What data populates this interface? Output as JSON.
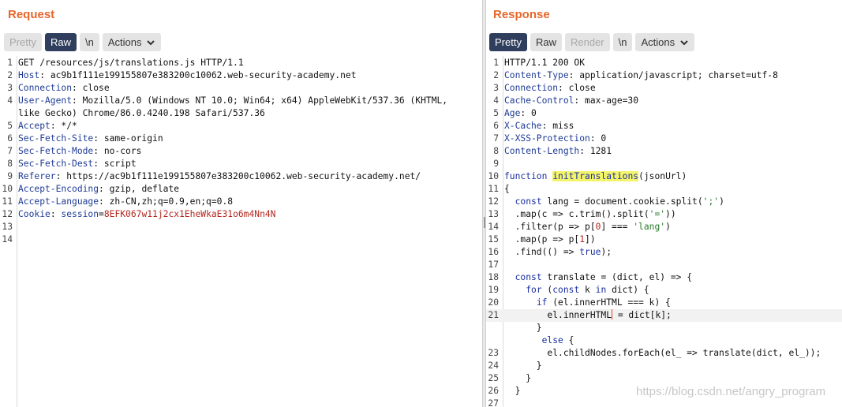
{
  "request": {
    "title": "Request",
    "tabs": {
      "pretty": "Pretty",
      "raw": "Raw",
      "newline": "\\n",
      "actions": "Actions"
    },
    "lines": [
      {
        "n": "1",
        "parts": [
          {
            "t": "GET /resources/js/translations.js HTTP/1.1"
          }
        ]
      },
      {
        "n": "2",
        "parts": [
          {
            "t": "Host",
            "c": "hdr"
          },
          {
            "t": ": ac9b1f111e199155807e383200c10062.web-security-academy.net"
          }
        ]
      },
      {
        "n": "3",
        "parts": [
          {
            "t": "Connection",
            "c": "hdr"
          },
          {
            "t": ": close"
          }
        ]
      },
      {
        "n": "4",
        "parts": [
          {
            "t": "User-Agent",
            "c": "hdr"
          },
          {
            "t": ": Mozilla/5.0 (Windows NT 10.0; Win64; x64) AppleWebKit/537.36 (KHTML,"
          }
        ]
      },
      {
        "n": "",
        "parts": [
          {
            "t": "like Gecko) Chrome/86.0.4240.198 Safari/537.36"
          }
        ]
      },
      {
        "n": "5",
        "parts": [
          {
            "t": "Accept",
            "c": "hdr"
          },
          {
            "t": ": */*"
          }
        ]
      },
      {
        "n": "6",
        "parts": [
          {
            "t": "Sec-Fetch-Site",
            "c": "hdr"
          },
          {
            "t": ": same-origin"
          }
        ]
      },
      {
        "n": "7",
        "parts": [
          {
            "t": "Sec-Fetch-Mode",
            "c": "hdr"
          },
          {
            "t": ": no-cors"
          }
        ]
      },
      {
        "n": "8",
        "parts": [
          {
            "t": "Sec-Fetch-Dest",
            "c": "hdr"
          },
          {
            "t": ": script"
          }
        ]
      },
      {
        "n": "9",
        "parts": [
          {
            "t": "Referer",
            "c": "hdr"
          },
          {
            "t": ": https://ac9b1f111e199155807e383200c10062.web-security-academy.net/"
          }
        ]
      },
      {
        "n": "10",
        "parts": [
          {
            "t": "Accept-Encoding",
            "c": "hdr"
          },
          {
            "t": ": gzip, deflate"
          }
        ]
      },
      {
        "n": "11",
        "parts": [
          {
            "t": "Accept-Language",
            "c": "hdr"
          },
          {
            "t": ": zh-CN,zh;q=0.9,en;q=0.8"
          }
        ]
      },
      {
        "n": "12",
        "parts": [
          {
            "t": "Cookie",
            "c": "hdr"
          },
          {
            "t": ": "
          },
          {
            "t": "session",
            "c": "hdr"
          },
          {
            "t": "="
          },
          {
            "t": "8EFK067w11j2cx1EheWkaE31o6m4Nn4N",
            "c": "cookie-val"
          }
        ]
      },
      {
        "n": "13",
        "parts": []
      },
      {
        "n": "14",
        "parts": []
      }
    ]
  },
  "response": {
    "title": "Response",
    "tabs": {
      "pretty": "Pretty",
      "raw": "Raw",
      "render": "Render",
      "newline": "\\n",
      "actions": "Actions"
    },
    "lines": [
      {
        "n": "1",
        "parts": [
          {
            "t": "HTTP/1.1 200 OK"
          }
        ]
      },
      {
        "n": "2",
        "parts": [
          {
            "t": "Content-Type",
            "c": "hdr"
          },
          {
            "t": ": application/javascript; charset=utf-8"
          }
        ]
      },
      {
        "n": "3",
        "parts": [
          {
            "t": "Connection",
            "c": "hdr"
          },
          {
            "t": ": close"
          }
        ]
      },
      {
        "n": "4",
        "parts": [
          {
            "t": "Cache-Control",
            "c": "hdr"
          },
          {
            "t": ": max-age=30"
          }
        ]
      },
      {
        "n": "5",
        "parts": [
          {
            "t": "Age",
            "c": "hdr"
          },
          {
            "t": ": 0"
          }
        ]
      },
      {
        "n": "6",
        "parts": [
          {
            "t": "X-Cache",
            "c": "hdr"
          },
          {
            "t": ": miss"
          }
        ]
      },
      {
        "n": "7",
        "parts": [
          {
            "t": "X-XSS-Protection",
            "c": "hdr"
          },
          {
            "t": ": 0"
          }
        ]
      },
      {
        "n": "8",
        "parts": [
          {
            "t": "Content-Length",
            "c": "hdr"
          },
          {
            "t": ": 1281"
          }
        ]
      },
      {
        "n": "9",
        "parts": []
      },
      {
        "n": "10",
        "parts": [
          {
            "t": "function",
            "c": "kw"
          },
          {
            "t": " "
          },
          {
            "t": "initTranslations",
            "c": "fn-hl"
          },
          {
            "t": "(jsonUrl)"
          }
        ]
      },
      {
        "n": "11",
        "parts": [
          {
            "t": "{"
          }
        ]
      },
      {
        "n": "12",
        "parts": [
          {
            "t": "  "
          },
          {
            "t": "const",
            "c": "kw"
          },
          {
            "t": " lang = document.cookie.split("
          },
          {
            "t": "';'",
            "c": "str"
          },
          {
            "t": ")"
          }
        ]
      },
      {
        "n": "13",
        "parts": [
          {
            "t": "  .map(c => c.trim().split("
          },
          {
            "t": "'='",
            "c": "str"
          },
          {
            "t": "))"
          }
        ]
      },
      {
        "n": "14",
        "parts": [
          {
            "t": "  .filter(p => p["
          },
          {
            "t": "0",
            "c": "num"
          },
          {
            "t": "] === "
          },
          {
            "t": "'lang'",
            "c": "str"
          },
          {
            "t": ")"
          }
        ]
      },
      {
        "n": "15",
        "parts": [
          {
            "t": "  .map(p => p["
          },
          {
            "t": "1",
            "c": "num"
          },
          {
            "t": "])"
          }
        ]
      },
      {
        "n": "16",
        "parts": [
          {
            "t": "  .find(() => "
          },
          {
            "t": "true",
            "c": "kw"
          },
          {
            "t": ");"
          }
        ]
      },
      {
        "n": "17",
        "parts": []
      },
      {
        "n": "18",
        "parts": [
          {
            "t": "  "
          },
          {
            "t": "const",
            "c": "kw"
          },
          {
            "t": " translate = (dict, el) => {"
          }
        ]
      },
      {
        "n": "19",
        "parts": [
          {
            "t": "    "
          },
          {
            "t": "for",
            "c": "kw"
          },
          {
            "t": " ("
          },
          {
            "t": "const",
            "c": "kw"
          },
          {
            "t": " k "
          },
          {
            "t": "in",
            "c": "kw"
          },
          {
            "t": " dict) {"
          }
        ]
      },
      {
        "n": "20",
        "parts": [
          {
            "t": "      "
          },
          {
            "t": "if",
            "c": "kw"
          },
          {
            "t": " (el.innerHTML === k) {"
          }
        ]
      },
      {
        "n": "21",
        "hl": true,
        "parts": [
          {
            "t": "        el.innerHTML"
          },
          {
            "cursor": true
          },
          {
            "t": " = dict[k];"
          }
        ]
      },
      {
        "n": "",
        "parts": [
          {
            "t": "      }"
          }
        ]
      },
      {
        "n": "",
        "parts": [
          {
            "t": "       "
          },
          {
            "t": "else",
            "c": "kw"
          },
          {
            "t": " {"
          }
        ]
      },
      {
        "n": "23",
        "parts": [
          {
            "t": "        el.childNodes.forEach(el_ => translate(dict, el_));"
          }
        ]
      },
      {
        "n": "24",
        "parts": [
          {
            "t": "      }"
          }
        ]
      },
      {
        "n": "25",
        "parts": [
          {
            "t": "    }"
          }
        ]
      },
      {
        "n": "26",
        "parts": [
          {
            "t": "  }"
          }
        ]
      },
      {
        "n": "27",
        "parts": []
      }
    ]
  },
  "watermark": "https://blog.csdn.net/angry_program"
}
